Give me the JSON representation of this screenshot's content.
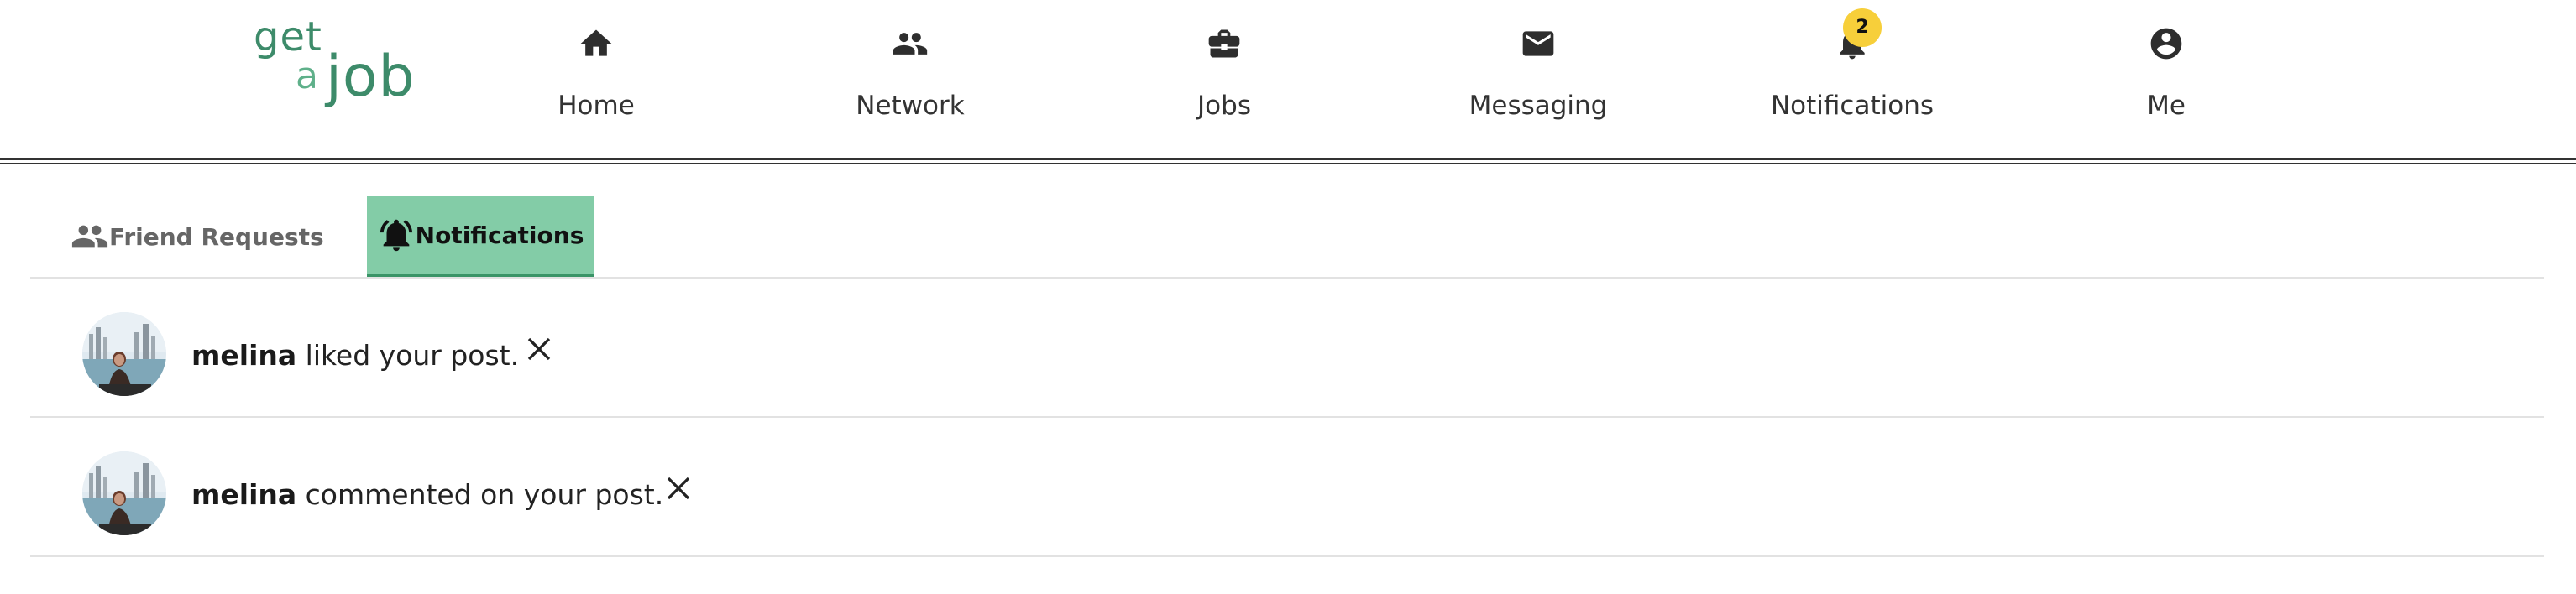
{
  "app": {
    "logo": {
      "word1": "get",
      "word2": "a",
      "word3": "job"
    }
  },
  "nav": {
    "items": [
      {
        "label": "Home",
        "icon": "home-icon"
      },
      {
        "label": "Network",
        "icon": "people-icon"
      },
      {
        "label": "Jobs",
        "icon": "briefcase-icon"
      },
      {
        "label": "Messaging",
        "icon": "envelope-icon"
      },
      {
        "label": "Notifications",
        "icon": "bell-icon",
        "badge": "2"
      },
      {
        "label": "Me",
        "icon": "account-circle-icon"
      }
    ]
  },
  "tabs": [
    {
      "label": "Friend Requests",
      "icon": "people-icon",
      "active": false
    },
    {
      "label": "Notifications",
      "icon": "bell-ringing-icon",
      "active": true
    }
  ],
  "notifications": [
    {
      "user": "melina",
      "message": " liked your post.",
      "avatar": "avatar-photo"
    },
    {
      "user": "melina",
      "message": " commented on your post.",
      "avatar": "avatar-photo"
    }
  ],
  "colors": {
    "brand": "#3d8b6a",
    "active_tab_bg": "#83cca7",
    "badge": "#f7cf3a"
  }
}
